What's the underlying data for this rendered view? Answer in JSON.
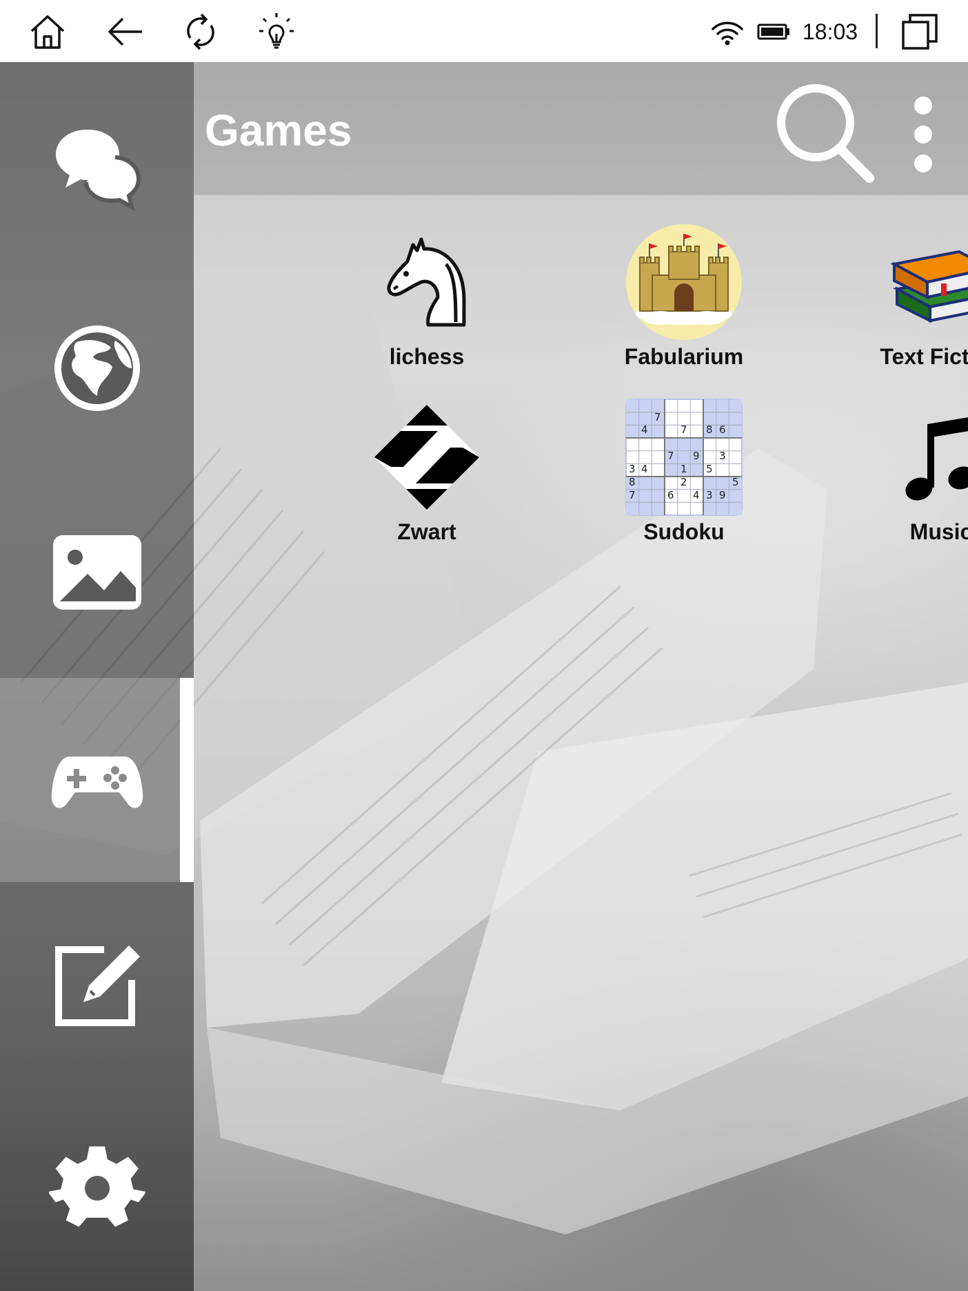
{
  "status_bar": {
    "time": "18:03",
    "icons": [
      "home-icon",
      "back-icon",
      "refresh-icon",
      "frontlight-icon",
      "wifi-icon",
      "battery-icon",
      "recent-apps-icon"
    ]
  },
  "header": {
    "title": "Games",
    "actions": [
      "search-icon",
      "more-vertical-icon"
    ]
  },
  "sidebar": {
    "items": [
      {
        "icon": "chat-icon",
        "active": false
      },
      {
        "icon": "globe-icon",
        "active": false
      },
      {
        "icon": "image-icon",
        "active": false
      },
      {
        "icon": "gamepad-icon",
        "active": true
      },
      {
        "icon": "edit-note-icon",
        "active": false
      },
      {
        "icon": "gear-icon",
        "active": false
      }
    ]
  },
  "apps": [
    {
      "label": "lichess",
      "icon": "chess-knight-icon"
    },
    {
      "label": "Fabularium",
      "icon": "castle-icon"
    },
    {
      "label": "Text Fiction",
      "icon": "books-icon"
    },
    {
      "label": "Zwart",
      "icon": "zwart-logo-icon"
    },
    {
      "label": "Sudoku",
      "icon": "sudoku-grid-icon"
    },
    {
      "label": "Music",
      "icon": "music-note-icon"
    }
  ],
  "sudoku_digits": [
    "7",
    "4",
    "7",
    "8",
    "6",
    "7",
    "9",
    "3",
    "3",
    "4",
    "1",
    "5",
    "8",
    "2",
    "5",
    "7",
    "6",
    "4",
    "3",
    "9"
  ],
  "colors": {
    "status_bar_bg": "#ffffff",
    "nav_active_indicator": "#ffffff",
    "title_text": "#ffffff",
    "sudoku_highlight": "#c9d2f2",
    "books_orange": "#f38b00",
    "books_green": "#2c8a2c",
    "books_navy": "#1e2e78",
    "castle_bg": "#f7ecaa"
  }
}
